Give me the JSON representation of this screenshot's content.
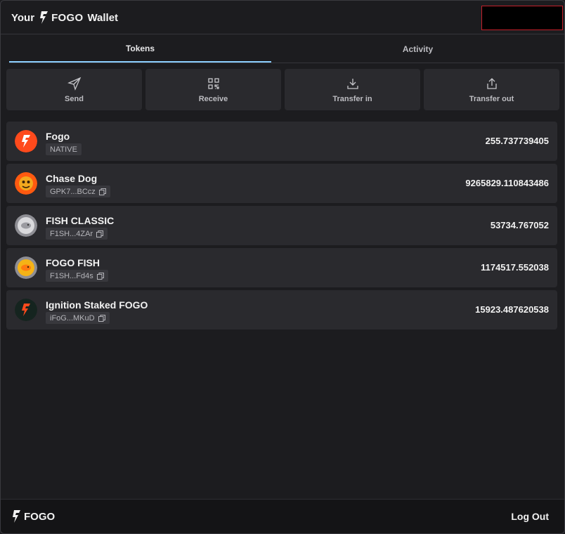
{
  "header": {
    "prefix": "Your",
    "brand": "FOGO",
    "suffix": "Wallet"
  },
  "tabs": [
    {
      "label": "Tokens",
      "active": true
    },
    {
      "label": "Activity",
      "active": false
    }
  ],
  "actions": [
    {
      "label": "Send",
      "icon": "send-icon"
    },
    {
      "label": "Receive",
      "icon": "qr-code-icon"
    },
    {
      "label": "Transfer in",
      "icon": "download-icon"
    },
    {
      "label": "Transfer out",
      "icon": "upload-icon"
    }
  ],
  "tokens": [
    {
      "name": "Fogo",
      "sub": "NATIVE",
      "amount": "255.737739405",
      "copyable": false
    },
    {
      "name": "Chase Dog",
      "sub": "GPK7...BCcz",
      "amount": "9265829.110843486",
      "copyable": true
    },
    {
      "name": "FISH CLASSIC",
      "sub": "F1SH...4ZAr",
      "amount": "53734.767052",
      "copyable": true
    },
    {
      "name": "FOGO FISH",
      "sub": "F1SH...Fd4s",
      "amount": "1174517.552038",
      "copyable": true
    },
    {
      "name": "Ignition Staked FOGO",
      "sub": "iFoG...MKuD",
      "amount": "15923.487620538",
      "copyable": true
    }
  ],
  "footer": {
    "brand": "FOGO",
    "logout_label": "Log Out"
  },
  "colors": {
    "background": "#1c1c1f",
    "card": "#2a2a2e",
    "accent_tab": "#8ccfff",
    "fogo_orange": "#ff4a1c"
  }
}
